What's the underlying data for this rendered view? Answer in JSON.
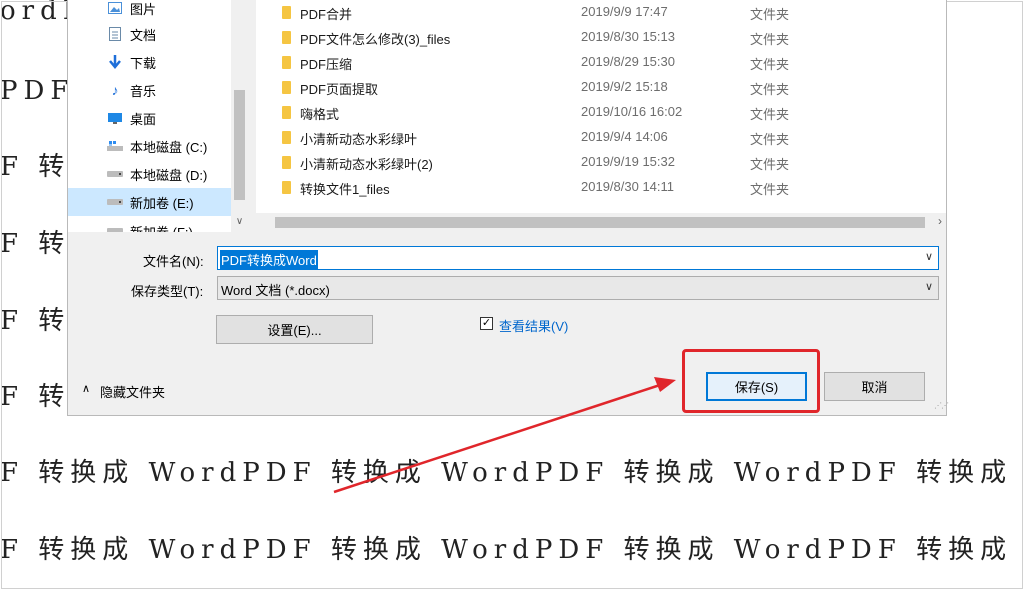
{
  "background_doc": {
    "lines": [
      "ordPI",
      "PDF 转",
      "F 转换",
      "F 转换",
      "F 转换",
      "F 转换",
      "F 转换成 WordPDF 转换成 WordPDF 转换成 WordPDF 转换成",
      "F 转换成 WordPDF 转换成 WordPDF 转换成 WordPDF 转换成"
    ]
  },
  "nav": {
    "items": [
      {
        "label": "图片",
        "icon": "picture-icon"
      },
      {
        "label": "文档",
        "icon": "document-icon"
      },
      {
        "label": "下载",
        "icon": "download-icon"
      },
      {
        "label": "音乐",
        "icon": "music-icon"
      },
      {
        "label": "桌面",
        "icon": "desktop-icon"
      },
      {
        "label": "本地磁盘 (C:)",
        "icon": "windows-drive-icon"
      },
      {
        "label": "本地磁盘 (D:)",
        "icon": "drive-icon"
      },
      {
        "label": "新加卷 (E:)",
        "icon": "drive-icon"
      },
      {
        "label": "新加卷 (F:)",
        "icon": "drive-icon"
      }
    ]
  },
  "files": [
    {
      "name": "PDF合并",
      "date": "2019/9/9 17:47",
      "type": "文件夹"
    },
    {
      "name": "PDF文件怎么修改(3)_files",
      "date": "2019/8/30 15:13",
      "type": "文件夹"
    },
    {
      "name": "PDF压缩",
      "date": "2019/8/29 15:30",
      "type": "文件夹"
    },
    {
      "name": "PDF页面提取",
      "date": "2019/9/2 15:18",
      "type": "文件夹"
    },
    {
      "name": "嗨格式",
      "date": "2019/10/16 16:02",
      "type": "文件夹"
    },
    {
      "name": "小清新动态水彩绿叶",
      "date": "2019/9/4 14:06",
      "type": "文件夹"
    },
    {
      "name": "小清新动态水彩绿叶(2)",
      "date": "2019/9/19 15:32",
      "type": "文件夹"
    },
    {
      "name": "转换文件1_files",
      "date": "2019/8/30 14:11",
      "type": "文件夹"
    }
  ],
  "form": {
    "filename_label": "文件名(N):",
    "filename_value": "PDF转换成Word",
    "savetype_label": "保存类型(T):",
    "savetype_value": "Word 文档 (*.docx)",
    "settings_button": "设置(E)...",
    "view_results_label": "查看结果(V)",
    "view_results_checked": "✓",
    "hide_folders_label": "隐藏文件夹",
    "save_button": "保存(S)",
    "cancel_button": "取消"
  },
  "colors": {
    "accent": "#0078d7",
    "highlight": "#e0262b"
  }
}
